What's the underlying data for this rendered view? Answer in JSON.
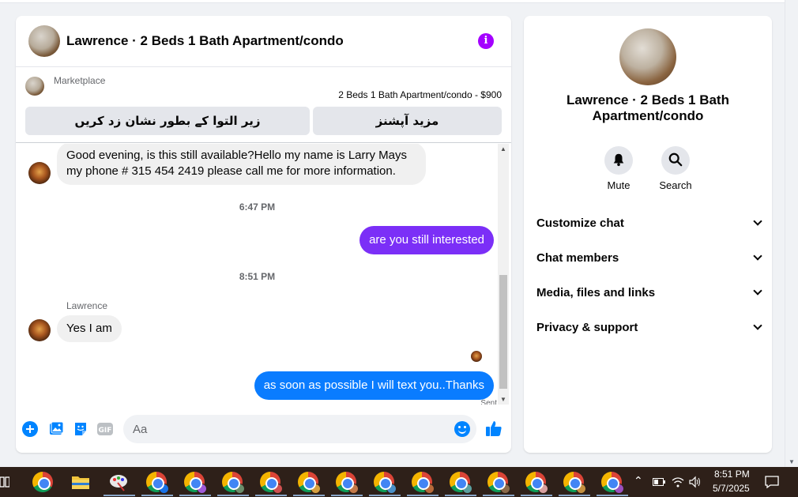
{
  "chat": {
    "title": "Lawrence · 2 Beds 1 Bath Apartment/condo",
    "marketplace": {
      "label": "Marketplace",
      "listing": "2 Beds 1 Bath Apartment/condo - $900",
      "mark_sold_button": "زیر التوا کے بطور نشان زد کریں",
      "more_options_button": "مزید آپشنز"
    },
    "messages": [
      {
        "direction": "in",
        "text_line1": "Good evening, is this still available?Hello my name is Larry Mays",
        "text_line2": "my phone # 315 454 2419 please call me for more information."
      },
      {
        "type": "timestamp",
        "text": "6:47 PM"
      },
      {
        "direction": "out",
        "text": "are you still interested",
        "color": "#7b2ff7"
      },
      {
        "type": "timestamp",
        "text": "8:51 PM"
      },
      {
        "sender": "Lawrence",
        "direction": "in",
        "text": "Yes I am"
      },
      {
        "direction": "out",
        "text": "as soon as possible I will text you..Thanks",
        "color": "#0a7cff"
      }
    ],
    "sent_status": "Sent",
    "composer": {
      "placeholder": "Aa"
    }
  },
  "info_panel": {
    "title": "Lawrence · 2 Beds 1 Bath Apartment/condo",
    "actions": [
      {
        "label": "Mute",
        "icon": "bell-icon"
      },
      {
        "label": "Search",
        "icon": "search-icon"
      }
    ],
    "sections": [
      "Customize chat",
      "Chat members",
      "Media, files and links",
      "Privacy & support"
    ]
  },
  "taskbar": {
    "time": "8:51 PM",
    "date": "5/7/2025"
  },
  "colors": {
    "accent": "#a400ff",
    "out_bubble_purple": "#7b2ff7",
    "out_bubble_blue": "#0a7cff",
    "icon_blue": "#0084ff"
  }
}
